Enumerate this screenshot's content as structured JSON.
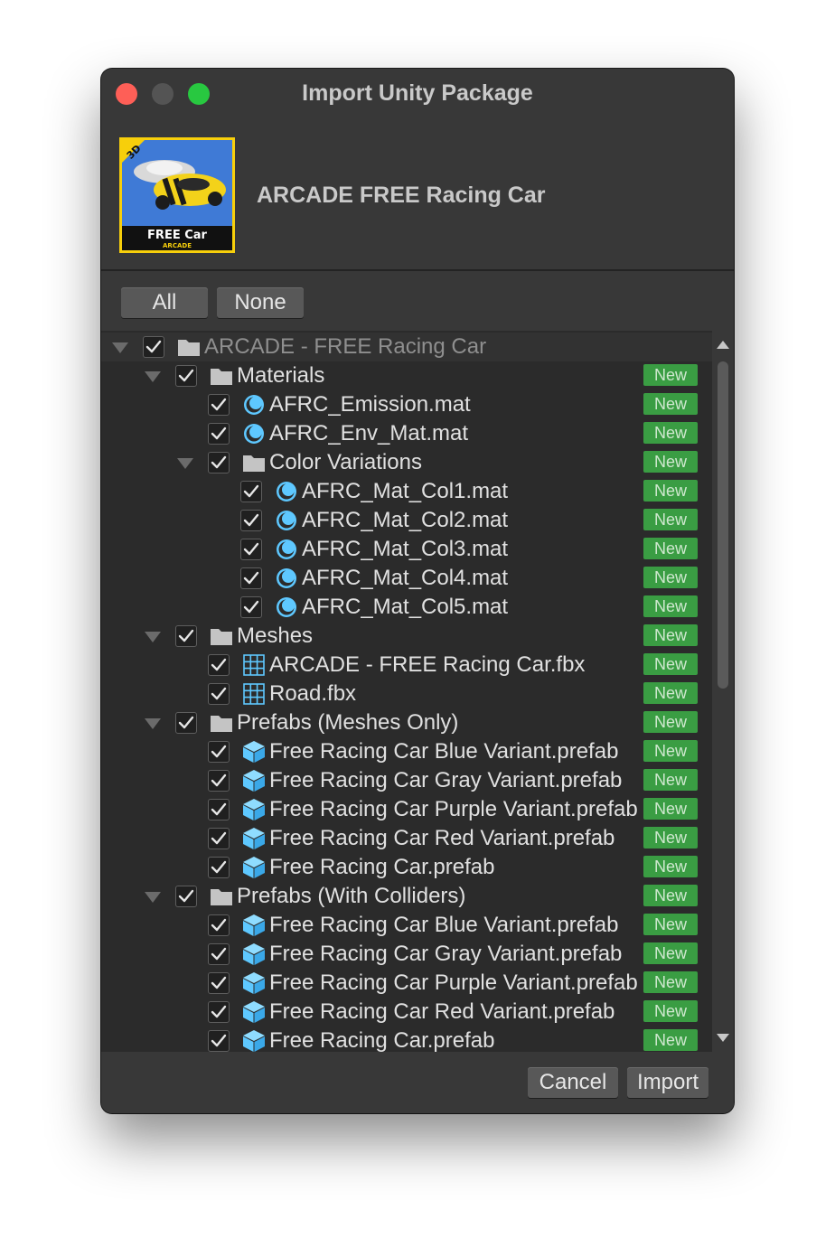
{
  "window": {
    "title": "Import Unity Package",
    "package_title": "ARCADE FREE Racing Car",
    "thumbnail": {
      "badge": "3D",
      "text_main": "FREE Car",
      "text_sub": "ARCADE"
    }
  },
  "toolbar": {
    "all_label": "All",
    "none_label": "None"
  },
  "new_badge": "New",
  "tree": [
    {
      "label": "ARCADE - FREE Racing Car",
      "depth": 0,
      "icon": "folder-icon",
      "expandable": true,
      "checked": true,
      "new": false
    },
    {
      "label": "Materials",
      "depth": 1,
      "icon": "folder-icon",
      "expandable": true,
      "checked": true,
      "new": true
    },
    {
      "label": "AFRC_Emission.mat",
      "depth": 2,
      "icon": "material-icon",
      "expandable": false,
      "checked": true,
      "new": true
    },
    {
      "label": "AFRC_Env_Mat.mat",
      "depth": 2,
      "icon": "material-icon",
      "expandable": false,
      "checked": true,
      "new": true
    },
    {
      "label": "Color Variations",
      "depth": 2,
      "icon": "folder-icon",
      "expandable": true,
      "checked": true,
      "new": true
    },
    {
      "label": "AFRC_Mat_Col1.mat",
      "depth": 3,
      "icon": "material-icon",
      "expandable": false,
      "checked": true,
      "new": true
    },
    {
      "label": "AFRC_Mat_Col2.mat",
      "depth": 3,
      "icon": "material-icon",
      "expandable": false,
      "checked": true,
      "new": true
    },
    {
      "label": "AFRC_Mat_Col3.mat",
      "depth": 3,
      "icon": "material-icon",
      "expandable": false,
      "checked": true,
      "new": true
    },
    {
      "label": "AFRC_Mat_Col4.mat",
      "depth": 3,
      "icon": "material-icon",
      "expandable": false,
      "checked": true,
      "new": true
    },
    {
      "label": "AFRC_Mat_Col5.mat",
      "depth": 3,
      "icon": "material-icon",
      "expandable": false,
      "checked": true,
      "new": true
    },
    {
      "label": "Meshes",
      "depth": 1,
      "icon": "folder-icon",
      "expandable": true,
      "checked": true,
      "new": true
    },
    {
      "label": "ARCADE - FREE Racing Car.fbx",
      "depth": 2,
      "icon": "mesh-icon",
      "expandable": false,
      "checked": true,
      "new": true
    },
    {
      "label": "Road.fbx",
      "depth": 2,
      "icon": "mesh-icon",
      "expandable": false,
      "checked": true,
      "new": true
    },
    {
      "label": "Prefabs (Meshes Only)",
      "depth": 1,
      "icon": "folder-icon",
      "expandable": true,
      "checked": true,
      "new": true
    },
    {
      "label": "Free Racing Car Blue Variant.prefab",
      "depth": 2,
      "icon": "prefab-icon",
      "expandable": false,
      "checked": true,
      "new": true
    },
    {
      "label": "Free Racing Car Gray Variant.prefab",
      "depth": 2,
      "icon": "prefab-icon",
      "expandable": false,
      "checked": true,
      "new": true
    },
    {
      "label": "Free Racing Car Purple Variant.prefab",
      "depth": 2,
      "icon": "prefab-icon",
      "expandable": false,
      "checked": true,
      "new": true
    },
    {
      "label": "Free Racing Car Red Variant.prefab",
      "depth": 2,
      "icon": "prefab-icon",
      "expandable": false,
      "checked": true,
      "new": true
    },
    {
      "label": "Free Racing Car.prefab",
      "depth": 2,
      "icon": "prefab-icon",
      "expandable": false,
      "checked": true,
      "new": true
    },
    {
      "label": "Prefabs (With Colliders)",
      "depth": 1,
      "icon": "folder-icon",
      "expandable": true,
      "checked": true,
      "new": true
    },
    {
      "label": "Free Racing Car Blue Variant.prefab",
      "depth": 2,
      "icon": "prefab-icon",
      "expandable": false,
      "checked": true,
      "new": true
    },
    {
      "label": "Free Racing Car Gray Variant.prefab",
      "depth": 2,
      "icon": "prefab-icon",
      "expandable": false,
      "checked": true,
      "new": true
    },
    {
      "label": "Free Racing Car Purple Variant.prefab",
      "depth": 2,
      "icon": "prefab-icon",
      "expandable": false,
      "checked": true,
      "new": true
    },
    {
      "label": "Free Racing Car Red Variant.prefab",
      "depth": 2,
      "icon": "prefab-icon",
      "expandable": false,
      "checked": true,
      "new": true
    },
    {
      "label": "Free Racing Car.prefab",
      "depth": 2,
      "icon": "prefab-icon",
      "expandable": false,
      "checked": true,
      "new": true
    }
  ],
  "footer": {
    "cancel_label": "Cancel",
    "import_label": "Import"
  },
  "colors": {
    "new_badge": "#3a9d43",
    "background": "#383838",
    "tree_background": "#2b2b2b",
    "accent_icon": "#5ec8ff"
  }
}
